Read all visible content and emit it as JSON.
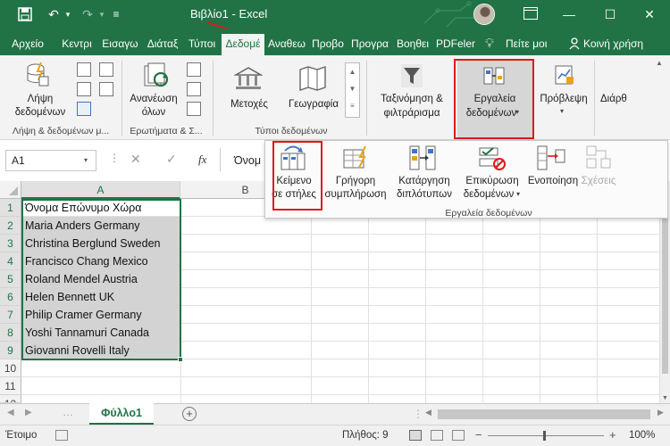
{
  "titlebar": {
    "title": "Βιβλίο1 - Excel"
  },
  "tabs": [
    {
      "label": "Αρχείο"
    },
    {
      "label": "Κεντρι"
    },
    {
      "label": "Εισαγω"
    },
    {
      "label": "Διάταξ"
    },
    {
      "label": "Τύποι"
    },
    {
      "label": "Δεδομέ"
    },
    {
      "label": "Αναθεω"
    },
    {
      "label": "Προβο"
    },
    {
      "label": "Προγρα"
    },
    {
      "label": "Βοηθει"
    },
    {
      "label": "PDFelen"
    }
  ],
  "tell_me": "Πείτε μοι",
  "share": "Κοινή χρήση",
  "ribbon": {
    "get_data": "Λήψη\nδεδομένων",
    "get_data_l1": "Λήψη",
    "get_data_l2": "δεδομένων",
    "group_get": "Λήψη & δεδομένων μ...",
    "refresh_l1": "Ανανέωση",
    "refresh_l2": "όλων",
    "group_queries": "Ερωτήματα & Σ...",
    "stocks": "Μετοχές",
    "geography": "Γεωγραφία",
    "group_types": "Τύποι δεδομένων",
    "sort_l1": "Ταξινόμηση &",
    "sort_l2": "φιλτράρισμα",
    "tools_l1": "Εργαλεία",
    "tools_l2": "δεδομένων",
    "forecast": "Πρόβλεψη",
    "outline": "Διάρθ"
  },
  "panel": {
    "text_to_cols_l1": "Κείμενο",
    "text_to_cols_l2": "σε στήλες",
    "flash_l1": "Γρήγορη",
    "flash_l2": "συμπλήρωση",
    "remove_l1": "Κατάργηση",
    "remove_l2": "διπλότυπων",
    "validate_l1": "Επικύρωση",
    "validate_l2": "δεδομένων",
    "consolidate": "Ενοποίηση",
    "relations": "Σχέσεις",
    "group": "Εργαλεία δεδομένων"
  },
  "formula": {
    "namebox": "A1",
    "fx": "fx",
    "content": "Όνομ"
  },
  "grid": {
    "columns": [
      "A",
      "B"
    ],
    "rows": [
      "1",
      "2",
      "3",
      "4",
      "5",
      "6",
      "7",
      "8",
      "9",
      "10",
      "11",
      "12"
    ],
    "cells": [
      "Όνομα Επώνυμο Χώρα",
      "Maria Anders Germany",
      "Christina Berglund Sweden",
      "Francisco Chang Mexico",
      "Roland Mendel Austria",
      "Helen Bennett UK",
      "Philip Cramer Germany",
      "Yoshi Tannamuri Canada",
      "Giovanni Rovelli Italy"
    ]
  },
  "sheet": {
    "tab": "Φύλλο1"
  },
  "status": {
    "ready": "Έτοιμο",
    "count": "Πλήθος: 9",
    "zoom": "100%"
  },
  "colors": {
    "accent": "#217346",
    "highlight": "#e0191a"
  }
}
